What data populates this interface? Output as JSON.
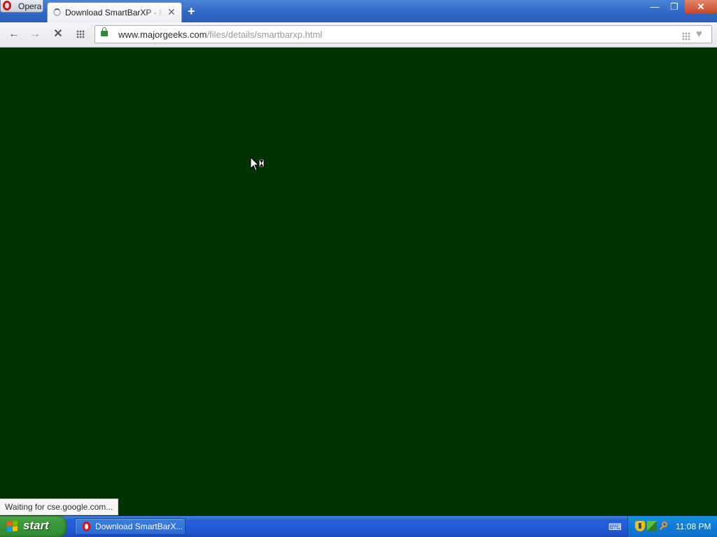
{
  "browser": {
    "menu_label": "Opera",
    "tab": {
      "title": "Download SmartBarXP - MajorGeeks"
    },
    "address": {
      "host": "www.majorgeeks.com",
      "path": "/files/details/smartbarxp.html"
    },
    "status_text": "Waiting for cse.google.com..."
  },
  "window_controls": {
    "minimize_glyph": "—",
    "maximize_glyph": "❐",
    "close_glyph": "✕"
  },
  "toolbar_glyphs": {
    "back": "←",
    "forward": "→",
    "stop": "✕",
    "tab_close": "✕",
    "new_tab": "+",
    "heart": "♥"
  },
  "taskbar": {
    "start_label": "start",
    "task_button_label": "Download SmartBarX...",
    "clock": "11:08 PM",
    "keyboard_glyph": "⌨"
  },
  "colors": {
    "page_background": "#003300",
    "start_button": "#3c9a3c",
    "taskbar": "#245edb"
  },
  "icons": [
    "opera-logo-icon",
    "loading-spinner-icon",
    "lock-icon",
    "speed-dial-icon",
    "heart-icon",
    "windows-logo-icon",
    "shield-icon",
    "network-icon",
    "search-icon",
    "keyboard-icon",
    "busy-cursor-icon"
  ]
}
